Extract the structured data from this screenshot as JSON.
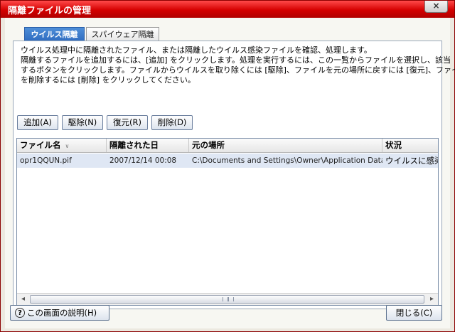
{
  "window": {
    "title": "隔離ファイルの管理",
    "close_glyph": "×"
  },
  "tabs": [
    {
      "label": "ウイルス隔離",
      "active": true
    },
    {
      "label": "スパイウェア隔離",
      "active": false
    }
  ],
  "description": {
    "line1": "ウイルス処理中に隔離されたファイル、または隔離したウイルス感染ファイルを確認、処理します。",
    "line2": "隔離するファイルを追加するには、[追加] をクリックします。処理を実行するには、この一覧からファイルを選択し、該当",
    "line3": "するボタンをクリックします。ファイルからウイルスを取り除くには [駆除]、ファイルを元の場所に戻すには [復元]、ファイル",
    "line4": "を削除するには [削除] をクリックしてください。"
  },
  "actions": {
    "add": "追加(A)",
    "clean": "駆除(N)",
    "restore": "復元(R)",
    "delete": "削除(D)"
  },
  "table": {
    "columns": [
      "ファイル名",
      "隔離された日",
      "元の場所",
      "状況"
    ],
    "sort_glyph": "∨",
    "rows": [
      {
        "filename": "opr1QQUN.pif",
        "date": "2007/12/14 00:08",
        "location": "C:\\Documents and Settings\\Owner\\Application Data\\O...",
        "status": "ウイルスに感染"
      }
    ]
  },
  "scrollbar": {
    "left_glyph": "◂",
    "right_glyph": "▸"
  },
  "footer": {
    "help_icon": "?",
    "help_label": "この画面の説明(H)",
    "close_label": "閉じる(C)"
  }
}
